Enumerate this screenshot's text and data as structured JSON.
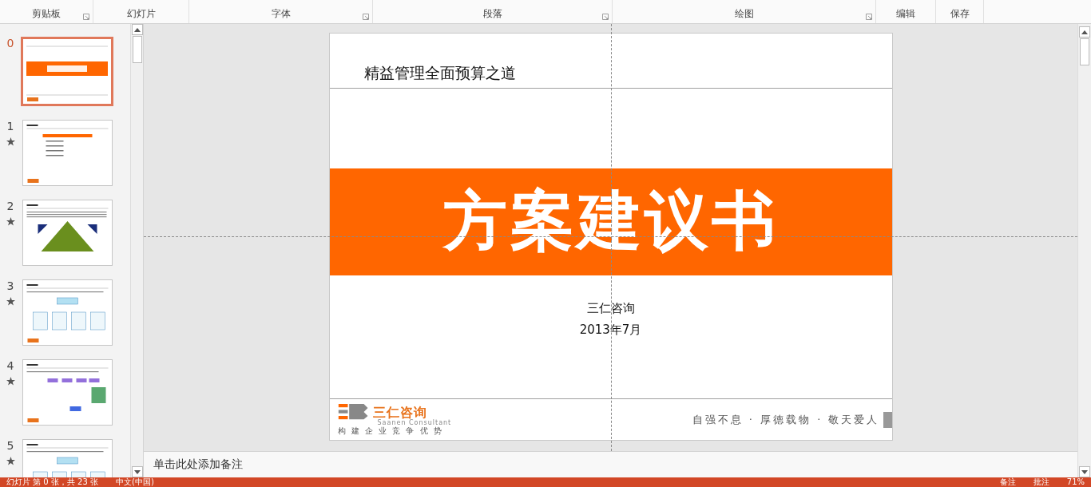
{
  "ribbon_groups": [
    {
      "label": "剪贴板",
      "launcher": true
    },
    {
      "label": "幻灯片",
      "launcher": false
    },
    {
      "label": "字体",
      "launcher": true
    },
    {
      "label": "段落",
      "launcher": true
    },
    {
      "label": "绘图",
      "launcher": true
    },
    {
      "label": "编辑",
      "launcher": false
    },
    {
      "label": "保存",
      "launcher": false
    }
  ],
  "thumbnails": [
    {
      "number": "0",
      "selected": true,
      "starred": false,
      "kind": "title"
    },
    {
      "number": "1",
      "selected": false,
      "starred": true,
      "kind": "agenda"
    },
    {
      "number": "2",
      "selected": false,
      "starred": true,
      "kind": "pyramid"
    },
    {
      "number": "3",
      "selected": false,
      "starred": true,
      "kind": "boxes"
    },
    {
      "number": "4",
      "selected": false,
      "starred": true,
      "kind": "flow"
    },
    {
      "number": "5",
      "selected": false,
      "starred": true,
      "kind": "boxes"
    }
  ],
  "slide": {
    "header": "精益管理全面预算之道",
    "title": "方案建议书",
    "company": "三仁咨询",
    "date": "2013年7月",
    "logo_name": "三仁咨询",
    "logo_english": "Saanen Consultant",
    "logo_tagline": "构 建 企 业 竞 争 优 势",
    "motto": "自强不息 · 厚德载物 · 敬天爱人"
  },
  "notes": {
    "placeholder": "单击此处添加备注"
  },
  "status_bar": {
    "slide_info": "幻灯片 第 0 张，共 23 张",
    "language": "中文(中国)",
    "notes_button": "备注",
    "comments_button": "批注",
    "zoom": "71%"
  }
}
